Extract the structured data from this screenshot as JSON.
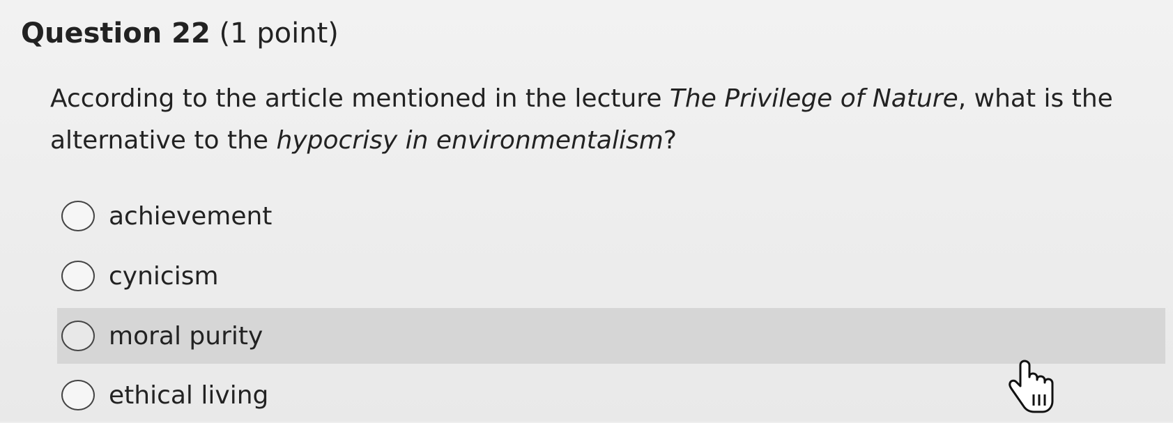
{
  "question": {
    "number": "Question 22",
    "points": "(1 point)",
    "text_parts": {
      "p1": "According to the article mentioned in the lecture ",
      "p2": "The Privilege of Nature",
      "p3": ", what is the alternative to the ",
      "p4": "hypocrisy in environmentalism",
      "p5": "?"
    }
  },
  "options": [
    {
      "label": "achievement",
      "selected": false
    },
    {
      "label": "cynicism",
      "selected": false
    },
    {
      "label": "moral purity",
      "selected": false,
      "hovered": true
    },
    {
      "label": "ethical living",
      "selected": false
    }
  ],
  "colors": {
    "background": "#efefef",
    "hover_row": "#d6d6d6",
    "text": "#222222"
  },
  "cursor": {
    "type": "hand-pointer-icon"
  }
}
